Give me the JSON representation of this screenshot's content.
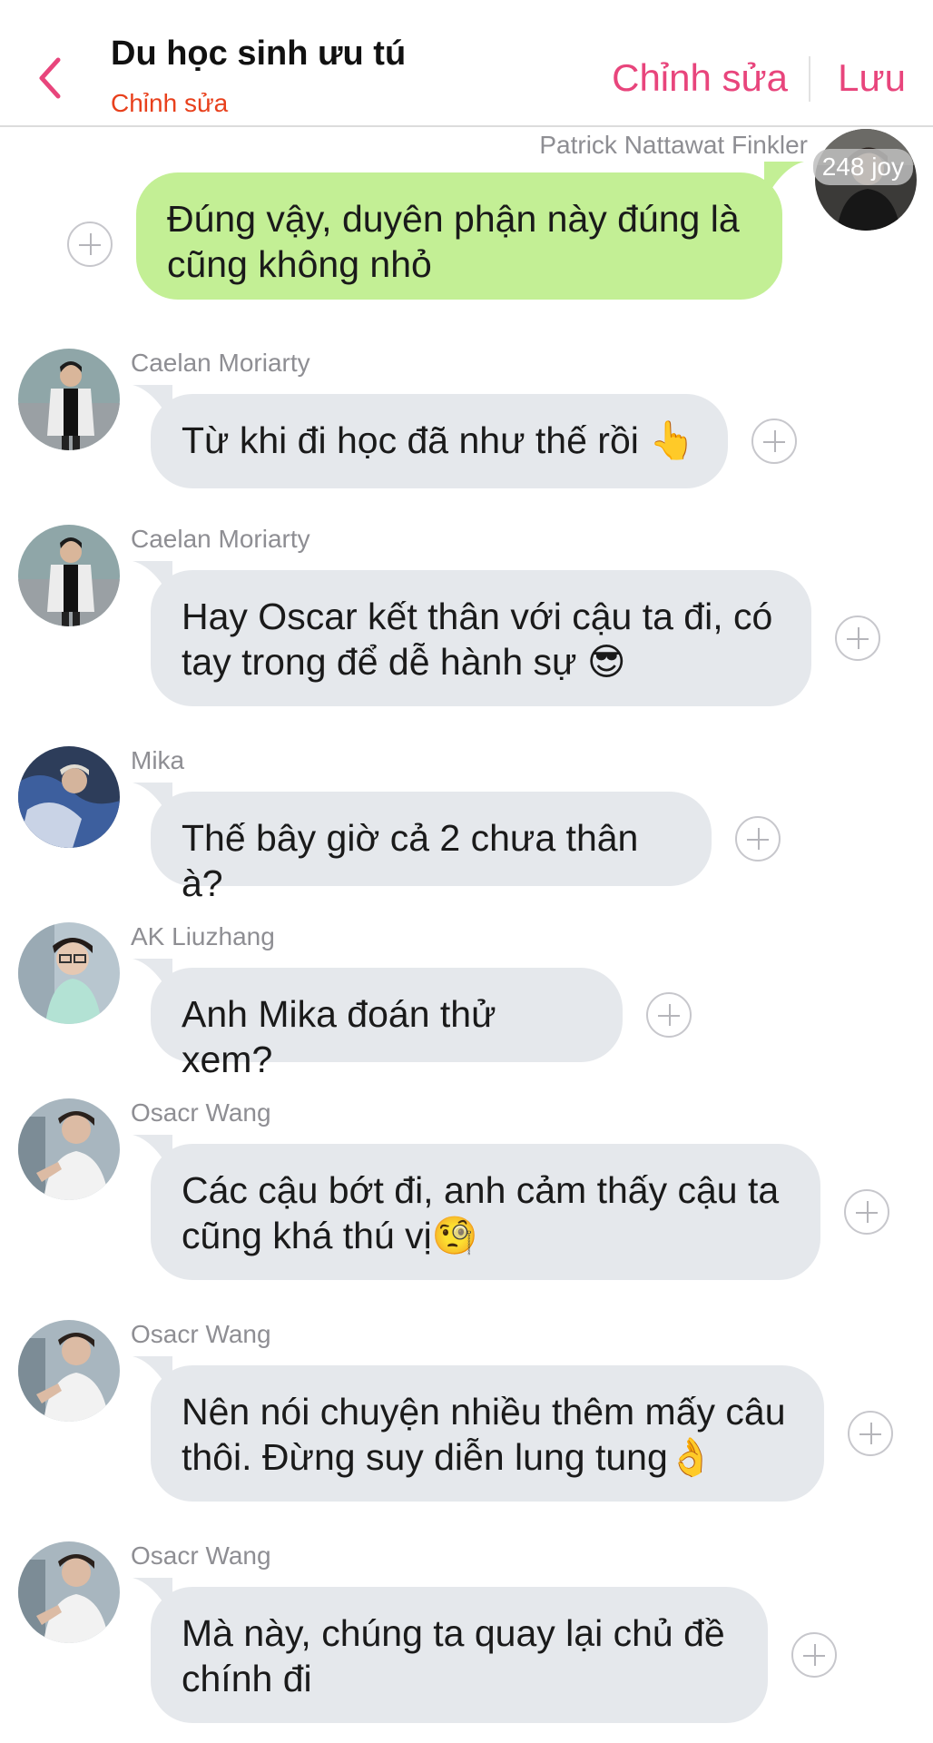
{
  "header": {
    "title": "Du học sinh ưu tú",
    "subtitle": "Chỉnh sửa",
    "edit_label": "Chỉnh sửa",
    "save_label": "Lưu"
  },
  "colors": {
    "accent": "#e8457c",
    "subtitle_red": "#e8401c",
    "my_bubble": "#c3ef95",
    "other_bubble": "#e5e8ec"
  },
  "messages": [
    {
      "sender": "Patrick Nattawat Finkler",
      "badge": "248 joy",
      "line1": "Đúng vậy, duyên phận này đúng là",
      "line2": "cũng không nhỏ",
      "mine": true
    },
    {
      "sender": "Caelan Moriarty",
      "line1": "Từ khi đi học đã như thế rồi 👆",
      "line2": ""
    },
    {
      "sender": "Caelan Moriarty",
      "line1": "Hay Oscar kết thân với cậu ta đi, có",
      "line2": "tay trong để dễ hành sự 😎"
    },
    {
      "sender": "Mika",
      "line1": "Thế bây giờ cả 2 chưa thân à?",
      "line2": ""
    },
    {
      "sender": "AK Liuzhang",
      "line1": "Anh Mika đoán thử xem?",
      "line2": ""
    },
    {
      "sender": "Osacr Wang",
      "line1": "Các cậu bớt đi, anh cảm thấy cậu ta",
      "line2": "cũng khá thú vị🧐"
    },
    {
      "sender": "Osacr Wang",
      "line1": "Nên nói chuyện nhiều thêm mấy câu",
      "line2": "thôi. Đừng suy diễn lung tung👌"
    },
    {
      "sender": "Osacr Wang",
      "line1": "Mà này, chúng ta quay lại chủ đề",
      "line2": "chính đi"
    }
  ]
}
